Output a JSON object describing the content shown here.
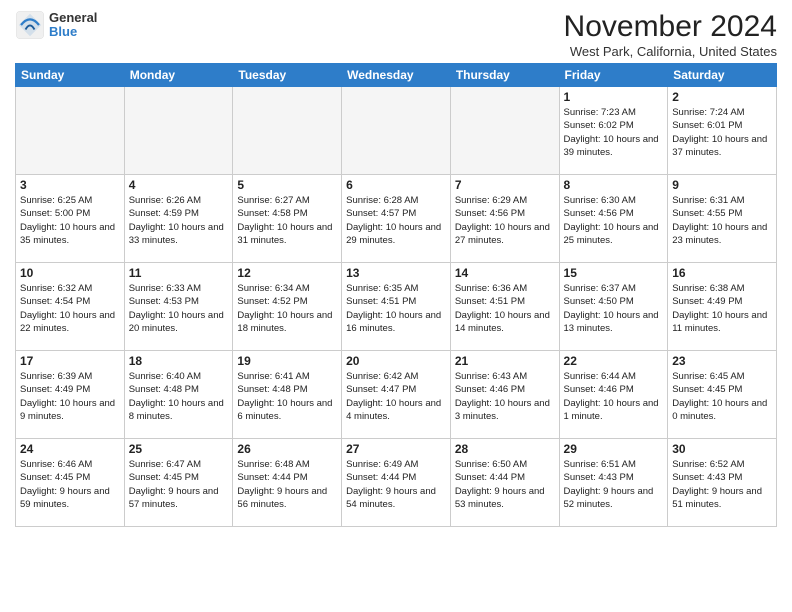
{
  "header": {
    "logo_line1": "General",
    "logo_line2": "Blue",
    "month_title": "November 2024",
    "location": "West Park, California, United States"
  },
  "days_of_week": [
    "Sunday",
    "Monday",
    "Tuesday",
    "Wednesday",
    "Thursday",
    "Friday",
    "Saturday"
  ],
  "weeks": [
    [
      {
        "day": "",
        "info": ""
      },
      {
        "day": "",
        "info": ""
      },
      {
        "day": "",
        "info": ""
      },
      {
        "day": "",
        "info": ""
      },
      {
        "day": "",
        "info": ""
      },
      {
        "day": "1",
        "info": "Sunrise: 7:23 AM\nSunset: 6:02 PM\nDaylight: 10 hours and 39 minutes."
      },
      {
        "day": "2",
        "info": "Sunrise: 7:24 AM\nSunset: 6:01 PM\nDaylight: 10 hours and 37 minutes."
      }
    ],
    [
      {
        "day": "3",
        "info": "Sunrise: 6:25 AM\nSunset: 5:00 PM\nDaylight: 10 hours and 35 minutes."
      },
      {
        "day": "4",
        "info": "Sunrise: 6:26 AM\nSunset: 4:59 PM\nDaylight: 10 hours and 33 minutes."
      },
      {
        "day": "5",
        "info": "Sunrise: 6:27 AM\nSunset: 4:58 PM\nDaylight: 10 hours and 31 minutes."
      },
      {
        "day": "6",
        "info": "Sunrise: 6:28 AM\nSunset: 4:57 PM\nDaylight: 10 hours and 29 minutes."
      },
      {
        "day": "7",
        "info": "Sunrise: 6:29 AM\nSunset: 4:56 PM\nDaylight: 10 hours and 27 minutes."
      },
      {
        "day": "8",
        "info": "Sunrise: 6:30 AM\nSunset: 4:56 PM\nDaylight: 10 hours and 25 minutes."
      },
      {
        "day": "9",
        "info": "Sunrise: 6:31 AM\nSunset: 4:55 PM\nDaylight: 10 hours and 23 minutes."
      }
    ],
    [
      {
        "day": "10",
        "info": "Sunrise: 6:32 AM\nSunset: 4:54 PM\nDaylight: 10 hours and 22 minutes."
      },
      {
        "day": "11",
        "info": "Sunrise: 6:33 AM\nSunset: 4:53 PM\nDaylight: 10 hours and 20 minutes."
      },
      {
        "day": "12",
        "info": "Sunrise: 6:34 AM\nSunset: 4:52 PM\nDaylight: 10 hours and 18 minutes."
      },
      {
        "day": "13",
        "info": "Sunrise: 6:35 AM\nSunset: 4:51 PM\nDaylight: 10 hours and 16 minutes."
      },
      {
        "day": "14",
        "info": "Sunrise: 6:36 AM\nSunset: 4:51 PM\nDaylight: 10 hours and 14 minutes."
      },
      {
        "day": "15",
        "info": "Sunrise: 6:37 AM\nSunset: 4:50 PM\nDaylight: 10 hours and 13 minutes."
      },
      {
        "day": "16",
        "info": "Sunrise: 6:38 AM\nSunset: 4:49 PM\nDaylight: 10 hours and 11 minutes."
      }
    ],
    [
      {
        "day": "17",
        "info": "Sunrise: 6:39 AM\nSunset: 4:49 PM\nDaylight: 10 hours and 9 minutes."
      },
      {
        "day": "18",
        "info": "Sunrise: 6:40 AM\nSunset: 4:48 PM\nDaylight: 10 hours and 8 minutes."
      },
      {
        "day": "19",
        "info": "Sunrise: 6:41 AM\nSunset: 4:48 PM\nDaylight: 10 hours and 6 minutes."
      },
      {
        "day": "20",
        "info": "Sunrise: 6:42 AM\nSunset: 4:47 PM\nDaylight: 10 hours and 4 minutes."
      },
      {
        "day": "21",
        "info": "Sunrise: 6:43 AM\nSunset: 4:46 PM\nDaylight: 10 hours and 3 minutes."
      },
      {
        "day": "22",
        "info": "Sunrise: 6:44 AM\nSunset: 4:46 PM\nDaylight: 10 hours and 1 minute."
      },
      {
        "day": "23",
        "info": "Sunrise: 6:45 AM\nSunset: 4:45 PM\nDaylight: 10 hours and 0 minutes."
      }
    ],
    [
      {
        "day": "24",
        "info": "Sunrise: 6:46 AM\nSunset: 4:45 PM\nDaylight: 9 hours and 59 minutes."
      },
      {
        "day": "25",
        "info": "Sunrise: 6:47 AM\nSunset: 4:45 PM\nDaylight: 9 hours and 57 minutes."
      },
      {
        "day": "26",
        "info": "Sunrise: 6:48 AM\nSunset: 4:44 PM\nDaylight: 9 hours and 56 minutes."
      },
      {
        "day": "27",
        "info": "Sunrise: 6:49 AM\nSunset: 4:44 PM\nDaylight: 9 hours and 54 minutes."
      },
      {
        "day": "28",
        "info": "Sunrise: 6:50 AM\nSunset: 4:44 PM\nDaylight: 9 hours and 53 minutes."
      },
      {
        "day": "29",
        "info": "Sunrise: 6:51 AM\nSunset: 4:43 PM\nDaylight: 9 hours and 52 minutes."
      },
      {
        "day": "30",
        "info": "Sunrise: 6:52 AM\nSunset: 4:43 PM\nDaylight: 9 hours and 51 minutes."
      }
    ]
  ]
}
